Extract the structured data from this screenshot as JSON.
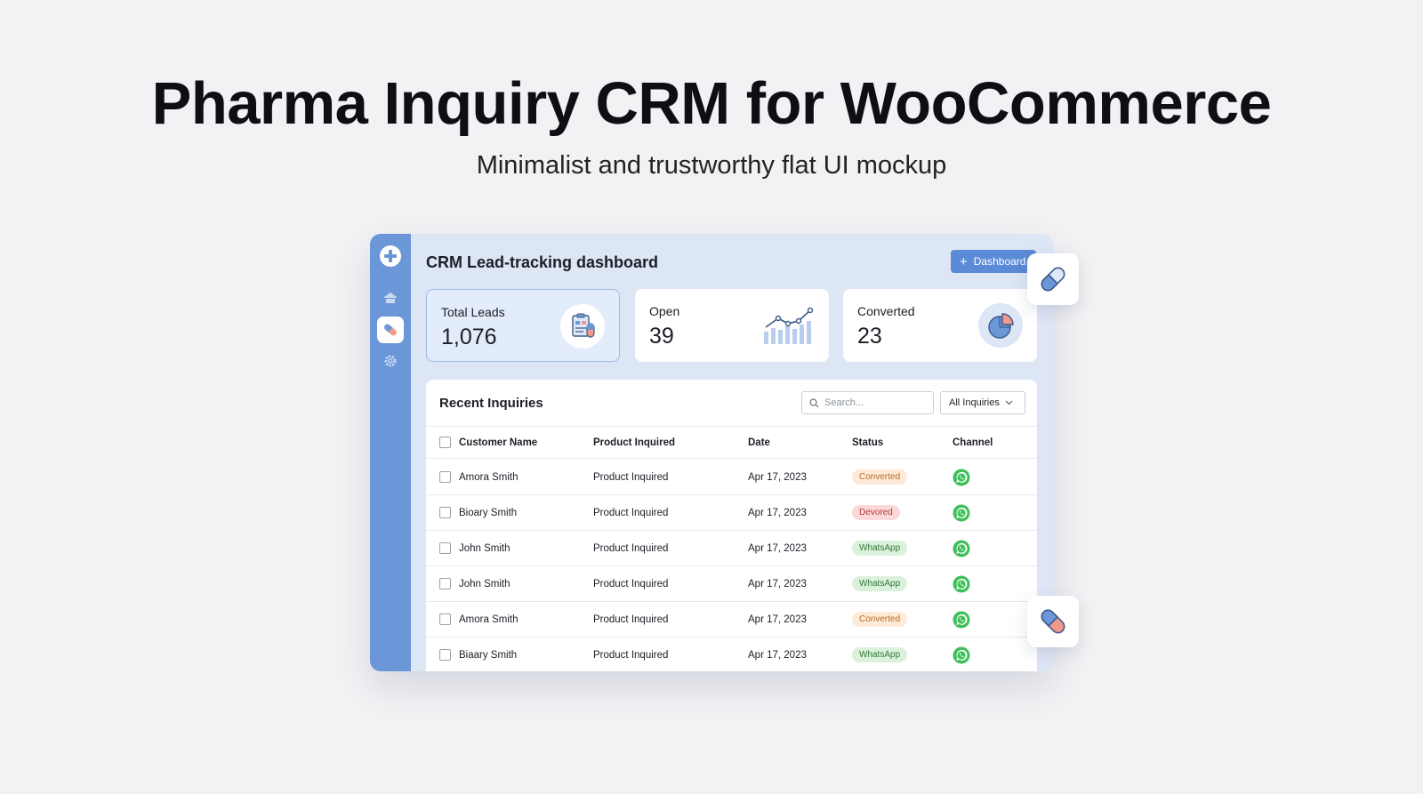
{
  "hero": {
    "title": "Pharma Inquiry CRM for WooCommerce",
    "subtitle": "Minimalist and trustworthy flat UI mockup"
  },
  "sidebar": {
    "items": [
      {
        "icon": "plus-circle-icon"
      },
      {
        "icon": "home-icon"
      },
      {
        "icon": "pill-icon",
        "active": true
      },
      {
        "icon": "gear-icon"
      }
    ]
  },
  "header": {
    "title": "CRM Lead-tracking dashboard",
    "button_label": "Dashboard"
  },
  "stats": [
    {
      "label": "Total Leads",
      "value": "1,076",
      "icon": "clipboard-pill-icon"
    },
    {
      "label": "Open",
      "value": "39",
      "icon": "line-bar-chart-icon"
    },
    {
      "label": "Converted",
      "value": "23",
      "icon": "pie-chart-icon"
    }
  ],
  "inquiries": {
    "title": "Recent Inquiries",
    "search_placeholder": "Search...",
    "filter_label": "All Inquiries",
    "columns": [
      "Customer Name",
      "Product Inquired",
      "Date",
      "Status",
      "Channel"
    ],
    "rows": [
      {
        "name": "Amora Smith",
        "product": "Product Inquired",
        "date": "Apr 17, 2023",
        "status": "Converted",
        "channel": "whatsapp-icon"
      },
      {
        "name": "Bioary Smith",
        "product": "Product Inquired",
        "date": "Apr 17, 2023",
        "status": "Devored",
        "channel": "whatsapp-icon"
      },
      {
        "name": "John Smith",
        "product": "Product Inquired",
        "date": "Apr 17, 2023",
        "status": "WhatsApp",
        "channel": "whatsapp-icon"
      },
      {
        "name": "John Smith",
        "product": "Product Inquired",
        "date": "Apr 17, 2023",
        "status": "WhatsApp",
        "channel": "whatsapp-icon"
      },
      {
        "name": "Amora Smith",
        "product": "Product Inquired",
        "date": "Apr 17, 2023",
        "status": "Converted",
        "channel": "whatsapp-icon"
      },
      {
        "name": "Biaary Smith",
        "product": "Product Inquired",
        "date": "Apr 17, 2023",
        "status": "WhatsApp",
        "channel": "whatsapp-icon"
      }
    ]
  },
  "colors": {
    "sidebar": "#6b97d9",
    "accent": "#5b8ad6",
    "converted": "#fdebd8",
    "devored": "#fbd9d9",
    "whatsapp": "#dcf1dc",
    "whatsapp_icon": "#3fbf5a"
  }
}
